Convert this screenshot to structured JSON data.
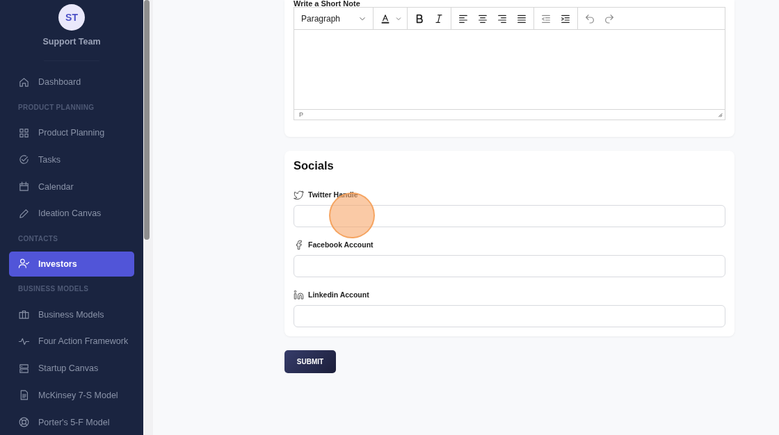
{
  "sidebar": {
    "avatar": "ST",
    "team": "Support Team",
    "entries": [
      {
        "kind": "item",
        "label": "Dashboard",
        "selected": false
      },
      {
        "kind": "section",
        "label": "PRODUCT PLANNING"
      },
      {
        "kind": "item",
        "label": "Product Planning",
        "selected": false
      },
      {
        "kind": "item",
        "label": "Tasks",
        "selected": false
      },
      {
        "kind": "item",
        "label": "Calendar",
        "selected": false
      },
      {
        "kind": "item",
        "label": "Ideation Canvas",
        "selected": false
      },
      {
        "kind": "section",
        "label": "CONTACTS"
      },
      {
        "kind": "item",
        "label": "Investors",
        "selected": true
      },
      {
        "kind": "section",
        "label": "BUSINESS MODELS"
      },
      {
        "kind": "item",
        "label": "Business Models",
        "selected": false
      },
      {
        "kind": "item",
        "label": "Four Action Framework",
        "selected": false
      },
      {
        "kind": "item",
        "label": "Startup Canvas",
        "selected": false
      },
      {
        "kind": "item",
        "label": "McKinsey 7-S Model",
        "selected": false
      },
      {
        "kind": "item",
        "label": "Porter's 5-F Model",
        "selected": false
      }
    ]
  },
  "note": {
    "label": "Write a Short Note",
    "block_format": "Paragraph",
    "path": "P"
  },
  "socials": {
    "title": "Socials",
    "fields": [
      {
        "label": "Twitter Handle"
      },
      {
        "label": "Facebook Account"
      },
      {
        "label": "Linkedin Account"
      }
    ]
  },
  "submit": "SUBMIT"
}
